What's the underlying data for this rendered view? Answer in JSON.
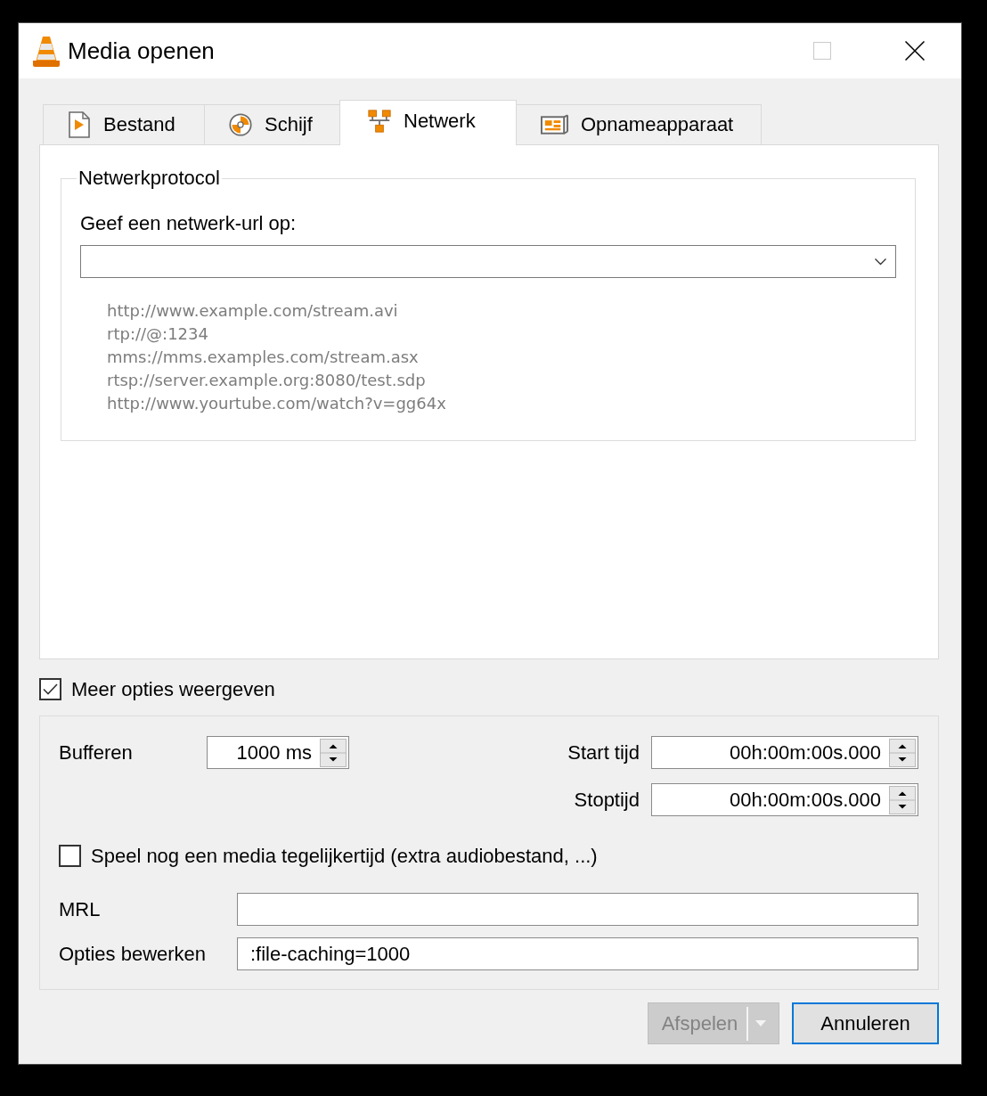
{
  "window": {
    "title": "Media openen",
    "controls": [
      {
        "kind": "maximize",
        "disabled": true
      },
      {
        "kind": "close",
        "disabled": false
      }
    ]
  },
  "tabs": [
    {
      "label": "Bestand",
      "selected": false
    },
    {
      "label": "Schijf",
      "selected": false
    },
    {
      "label": "Netwerk",
      "selected": true
    },
    {
      "label": "Opnameapparaat",
      "selected": false
    }
  ],
  "network": {
    "group_title": "Netwerkprotocol",
    "url_label": "Geef een netwerk-url op:",
    "examples": [
      "http://www.example.com/stream.avi",
      "rtp://@:1234",
      "mms://mms.examples.com/stream.asx",
      "rtsp://server.example.org:8080/test.sdp",
      "http://www.yourtube.com/watch?v=gg64x"
    ]
  },
  "more_options": {
    "label": "Meer opties weergeven",
    "checked": true
  },
  "options": {
    "caching": {
      "label": "Bufferen",
      "value": "1000 ms"
    },
    "times": [
      {
        "label": "Start tijd",
        "value": "00h:00m:00s.000"
      },
      {
        "label": "Stoptijd",
        "value": "00h:00m:00s.000"
      }
    ],
    "play_another": {
      "label": "Speel nog een media tegelijkertijd (extra audiobestand, ...)",
      "checked": false
    },
    "fields": [
      {
        "label": "MRL"
      },
      {
        "label": "Opties bewerken",
        "value": ":file-caching=1000"
      }
    ]
  },
  "buttons": [
    {
      "label": "Afspelen",
      "kind": "split",
      "disabled": true,
      "focused": false
    },
    {
      "label": "Annuleren",
      "kind": "push",
      "disabled": false,
      "focused": true
    }
  ]
}
